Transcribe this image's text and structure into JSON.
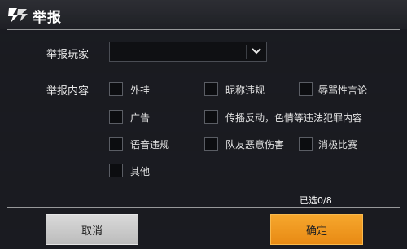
{
  "dialog": {
    "title": "举报",
    "player_label": "举报玩家",
    "player_value": "",
    "content_label": "举报内容",
    "options": [
      {
        "label": "外挂",
        "checked": false
      },
      {
        "label": "昵称违规",
        "checked": false
      },
      {
        "label": "辱骂性言论",
        "checked": false
      },
      {
        "label": "广告",
        "checked": false
      },
      {
        "label": "传播反动，色情等违法犯罪内容",
        "checked": false
      },
      {
        "label": "语音违规",
        "checked": false
      },
      {
        "label": "队友恶意伤害",
        "checked": false
      },
      {
        "label": "消极比赛",
        "checked": false
      },
      {
        "label": "其他",
        "checked": false
      }
    ],
    "selected_count": "已选0/8",
    "cancel_label": "取消",
    "confirm_label": "确定"
  },
  "colors": {
    "accent": "#f39c1f",
    "cancel": "#cfcfcf",
    "panel": "#181a1f"
  },
  "icons": {
    "logo": "game-logo-icon",
    "dropdown": "chevron-down-icon"
  }
}
